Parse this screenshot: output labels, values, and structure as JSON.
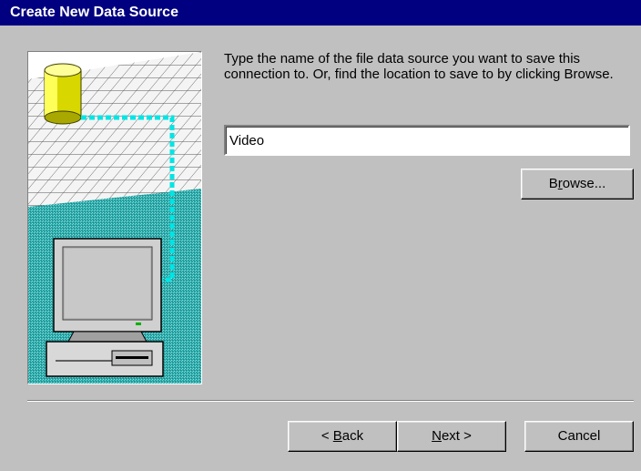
{
  "window": {
    "title": "Create New Data Source"
  },
  "wizard": {
    "instructions": "Type the name of the file data source you want to save this connection to.  Or, find the location to save to by clicking Browse.",
    "filename_value": "Video"
  },
  "buttons": {
    "browse": {
      "pre": "B",
      "accel": "r",
      "post": "owse..."
    },
    "back": {
      "pre": "< ",
      "accel": "B",
      "post": "ack"
    },
    "next": {
      "pre": "",
      "accel": "N",
      "post": "ext >"
    },
    "cancel": {
      "label": "Cancel"
    }
  },
  "colors": {
    "titlebar": "#000080",
    "face": "#c0c0c0",
    "teal": "#1aa5a5",
    "cyan_link": "#00e5e5",
    "cylinder": "#e8e800"
  },
  "icons": {
    "illustration": "database-to-computer-illustration"
  }
}
